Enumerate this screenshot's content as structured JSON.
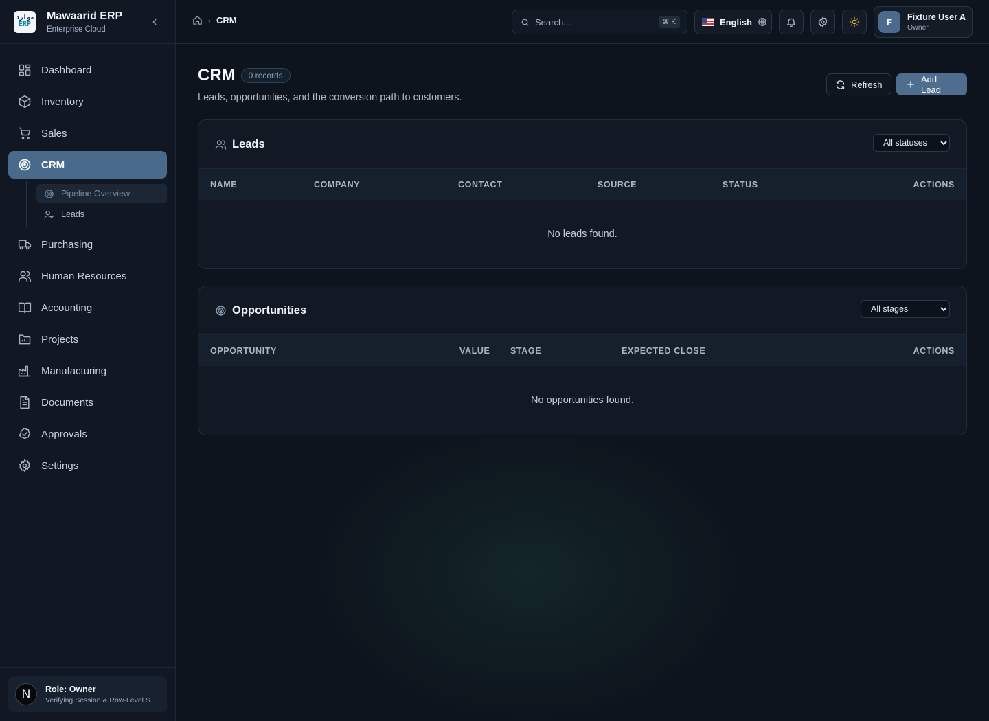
{
  "brand": {
    "name": "Mawaarid ERP",
    "subtitle": "Enterprise Cloud",
    "logo_top": "موارد",
    "logo_bottom": "ERP"
  },
  "sidebar": {
    "items": [
      {
        "label": "Dashboard",
        "icon": "grid-icon"
      },
      {
        "label": "Inventory",
        "icon": "box-icon"
      },
      {
        "label": "Sales",
        "icon": "cart-icon"
      },
      {
        "label": "CRM",
        "icon": "target-icon",
        "active": true
      },
      {
        "label": "Purchasing",
        "icon": "truck-icon"
      },
      {
        "label": "Human Resources",
        "icon": "users-icon"
      },
      {
        "label": "Accounting",
        "icon": "book-icon"
      },
      {
        "label": "Projects",
        "icon": "folder-icon"
      },
      {
        "label": "Manufacturing",
        "icon": "factory-icon"
      },
      {
        "label": "Documents",
        "icon": "document-icon"
      },
      {
        "label": "Approvals",
        "icon": "check-badge-icon"
      },
      {
        "label": "Settings",
        "icon": "gear-icon"
      }
    ],
    "crm_sub": [
      {
        "label": "Pipeline Overview",
        "icon": "target-icon",
        "active": true
      },
      {
        "label": "Leads",
        "icon": "user-check-icon"
      }
    ],
    "footer": {
      "avatar": "N",
      "role": "Role: Owner",
      "detail": "Verifying Session & Row-Level S..."
    }
  },
  "topbar": {
    "breadcrumb": "CRM",
    "search_placeholder": "Search...",
    "search_shortcut": "⌘ K",
    "language": "English",
    "user": {
      "initial": "F",
      "name": "Fixture User A",
      "role": "Owner"
    }
  },
  "page": {
    "title": "CRM",
    "count_badge": "0 records",
    "subtitle": "Leads, opportunities, and the conversion path to customers.",
    "refresh_label": "Refresh",
    "add_label": "Add Lead"
  },
  "leads": {
    "title": "Leads",
    "filter_value": "All statuses",
    "columns": [
      "NAME",
      "COMPANY",
      "CONTACT",
      "SOURCE",
      "STATUS",
      "ACTIONS"
    ],
    "empty": "No leads found."
  },
  "opportunities": {
    "title": "Opportunities",
    "filter_value": "All stages",
    "columns": [
      "OPPORTUNITY",
      "VALUE",
      "STAGE",
      "EXPECTED CLOSE",
      "ACTIONS"
    ],
    "empty": "No opportunities found."
  },
  "colors": {
    "accent": "#4e6d8f",
    "background": "#0e141d",
    "sidebar": "#111824"
  }
}
